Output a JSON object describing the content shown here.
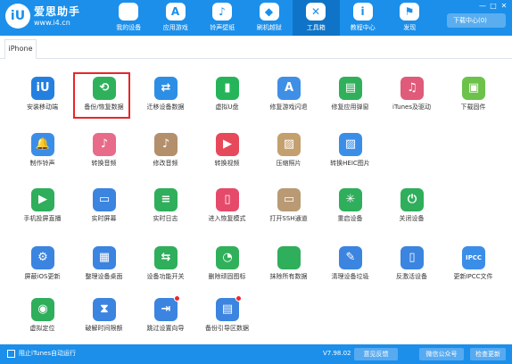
{
  "app": {
    "logo_mark": "iU",
    "name": "爱思助手",
    "url": "www.i4.cn"
  },
  "nav": [
    {
      "label": "我的设备",
      "icon": "apple-icon",
      "glyph": ""
    },
    {
      "label": "应用游戏",
      "icon": "app-store-icon",
      "glyph": "A"
    },
    {
      "label": "铃声壁纸",
      "icon": "music-icon",
      "glyph": "♪"
    },
    {
      "label": "刷机越狱",
      "icon": "box-icon",
      "glyph": "◆"
    },
    {
      "label": "工具箱",
      "icon": "tools-icon",
      "glyph": "✕"
    },
    {
      "label": "教程中心",
      "icon": "info-icon",
      "glyph": "i"
    },
    {
      "label": "发现",
      "icon": "flag-icon",
      "glyph": "⚑"
    }
  ],
  "header": {
    "download_label": "下载中心(0)",
    "win_controls": [
      "—",
      "□",
      "✕"
    ]
  },
  "tab": {
    "label": "iPhone"
  },
  "tiles": [
    {
      "label": "安装移动端",
      "color": "#2480e0",
      "glyph": "iU",
      "icon": "install-mobile-icon"
    },
    {
      "label": "备份/恢复数据",
      "color": "#2fb15c",
      "glyph": "⟲",
      "icon": "backup-restore-icon"
    },
    {
      "label": "迁移设备数据",
      "color": "#2d8ee6",
      "glyph": "⇄",
      "icon": "migrate-data-icon"
    },
    {
      "label": "虚拟U盘",
      "color": "#25b45a",
      "glyph": "▮",
      "icon": "virtual-usb-icon"
    },
    {
      "label": "修复游戏闪退",
      "color": "#3f8fe6",
      "glyph": "A",
      "icon": "fix-game-crash-icon"
    },
    {
      "label": "修复应用弹窗",
      "color": "#31b05b",
      "glyph": "▤",
      "icon": "fix-app-popup-icon"
    },
    {
      "label": "iTunes及驱动",
      "color": "#e05a7a",
      "glyph": "♫",
      "icon": "itunes-driver-icon"
    },
    {
      "label": "下载固件",
      "color": "#6cc24a",
      "glyph": "▣",
      "icon": "download-firmware-icon"
    },
    {
      "label": "制作铃声",
      "color": "#3b8ee8",
      "glyph": "🔔",
      "icon": "make-ringtone-icon"
    },
    {
      "label": "转换音频",
      "color": "#e86b8a",
      "glyph": "♪",
      "icon": "convert-audio-icon"
    },
    {
      "label": "修改音频",
      "color": "#b38f6b",
      "glyph": "♪",
      "icon": "edit-audio-icon"
    },
    {
      "label": "转换视频",
      "color": "#e64a5a",
      "glyph": "▶",
      "icon": "convert-video-icon"
    },
    {
      "label": "压缩照片",
      "color": "#c4a06e",
      "glyph": "▨",
      "icon": "compress-photo-icon"
    },
    {
      "label": "转换HEIC图片",
      "color": "#3b8ee8",
      "glyph": "▨",
      "icon": "convert-heic-icon"
    },
    {
      "label": "手机投屏直播",
      "color": "#2fae5b",
      "glyph": "▶",
      "icon": "screen-mirror-icon"
    },
    {
      "label": "实时屏幕",
      "color": "#3b84e0",
      "glyph": "▭",
      "icon": "live-screen-icon"
    },
    {
      "label": "实时日志",
      "color": "#2fae5b",
      "glyph": "≡",
      "icon": "live-log-icon"
    },
    {
      "label": "进入恢复模式",
      "color": "#e64a6a",
      "glyph": "▯",
      "icon": "recovery-mode-icon"
    },
    {
      "label": "打开SSH通道",
      "color": "#b99a74",
      "glyph": "▭",
      "icon": "ssh-tunnel-icon"
    },
    {
      "label": "重启设备",
      "color": "#2fae5b",
      "glyph": "✳",
      "icon": "restart-device-icon"
    },
    {
      "label": "关闭设备",
      "color": "#2fae5b",
      "glyph": "⏻",
      "icon": "shutdown-device-icon"
    },
    {
      "label": "屏蔽iOS更新",
      "color": "#3b84e0",
      "glyph": "⚙",
      "icon": "block-ios-update-icon"
    },
    {
      "label": "整理设备桌面",
      "color": "#3b84e0",
      "glyph": "▦",
      "icon": "organize-desktop-icon"
    },
    {
      "label": "设备功能开关",
      "color": "#2fae5b",
      "glyph": "⇆",
      "icon": "feature-toggle-icon"
    },
    {
      "label": "删除顽固图标",
      "color": "#31b05b",
      "glyph": "◔",
      "icon": "delete-icon-icon"
    },
    {
      "label": "抹除所有数据",
      "color": "#2fae5b",
      "glyph": "",
      "icon": "erase-data-icon"
    },
    {
      "label": "清理设备垃圾",
      "color": "#3b84e0",
      "glyph": "✎",
      "icon": "clean-junk-icon"
    },
    {
      "label": "反激活设备",
      "color": "#3b84e0",
      "glyph": "▯",
      "icon": "deactivate-device-icon"
    },
    {
      "label": "更新IPCC文件",
      "color": "#3b8ee8",
      "glyph": "IPCC",
      "icon": "update-ipcc-icon"
    },
    {
      "label": "虚拟定位",
      "color": "#2fae5b",
      "glyph": "◉",
      "icon": "virtual-location-icon"
    },
    {
      "label": "破解时间限额",
      "color": "#3b84e0",
      "glyph": "⧗",
      "icon": "time-limit-icon"
    },
    {
      "label": "跳过设置向导",
      "color": "#3b84e0",
      "glyph": "⇥",
      "icon": "skip-setup-icon",
      "dot": true
    },
    {
      "label": "备份引导区数据",
      "color": "#3b84e0",
      "glyph": "▤",
      "icon": "backup-boot-icon",
      "dot": true
    }
  ],
  "footer": {
    "itunes_autorun": "阻止iTunes自动运行",
    "version": "V7.98.02",
    "feedback": "意见反馈",
    "wechat": "微信公众号",
    "check_update": "检查更新"
  }
}
